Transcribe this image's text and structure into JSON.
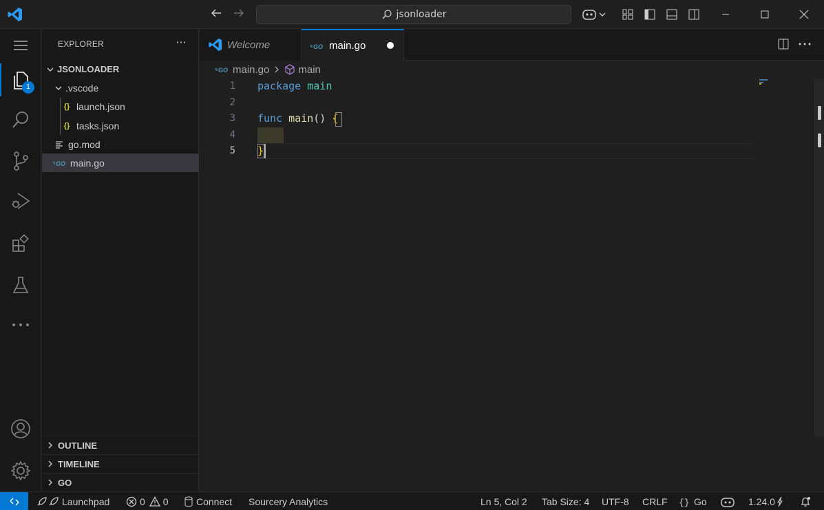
{
  "titlebar": {
    "search_text": "jsonloader"
  },
  "activitybar": {
    "explorer_badge": "1"
  },
  "sidebar": {
    "title": "EXPLORER",
    "more": "···",
    "root": "JSONLOADER",
    "items": [
      {
        "label": ".vscode",
        "icon": "chevron-down-icon"
      },
      {
        "label": "launch.json",
        "icon": "json-braces-icon"
      },
      {
        "label": "tasks.json",
        "icon": "json-braces-icon"
      },
      {
        "label": "go.mod",
        "icon": "lines-icon"
      },
      {
        "label": "main.go",
        "icon": "go-icon"
      }
    ],
    "sections": [
      "OUTLINE",
      "TIMELINE",
      "GO"
    ]
  },
  "tabs": [
    {
      "label": "Welcome"
    },
    {
      "label": "main.go"
    }
  ],
  "breadcrumb": {
    "file": "main.go",
    "symbol": "main"
  },
  "editor": {
    "line_numbers": [
      "1",
      "2",
      "3",
      "4",
      "5"
    ],
    "code": {
      "l1_kw": "package",
      "l1_pkg": "main",
      "l3_kw": "func",
      "l3_fn": "main",
      "l3_parens": "()",
      "l3_brace": "{",
      "l5_brace": "}"
    }
  },
  "statusbar": {
    "launchpad": "Launchpad",
    "errors": "0",
    "warnings": "0",
    "connect": "Connect",
    "sourcery": "Sourcery Analytics",
    "position": "Ln 5, Col 2",
    "tab_size": "Tab Size: 4",
    "encoding": "UTF-8",
    "eol": "CRLF",
    "language": "Go",
    "go_version": "1.24.0"
  },
  "colors": {
    "accent": "#0078d4",
    "background": "#1f1f1f",
    "sidebar": "#181818",
    "keyword": "#569cd6",
    "package": "#4ec9b0",
    "function": "#dcdcaa",
    "brace": "#ffd700"
  }
}
